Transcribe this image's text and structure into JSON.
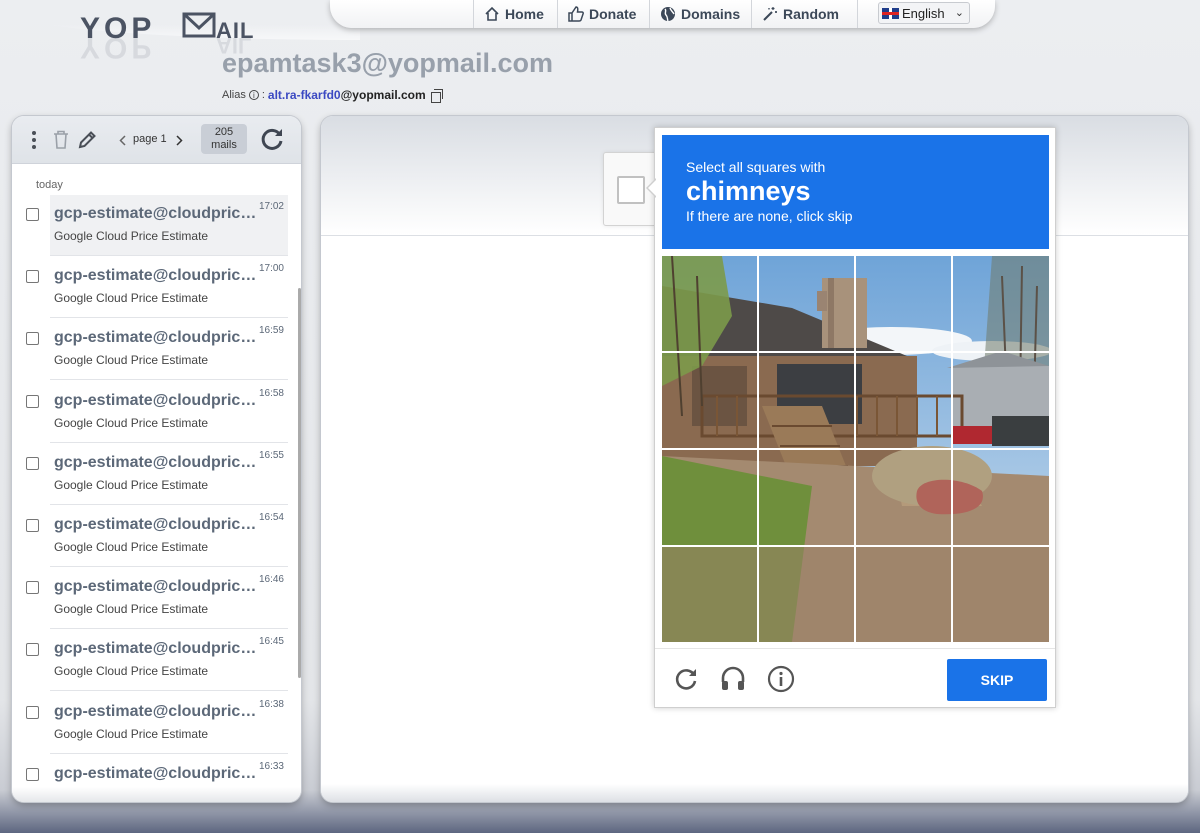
{
  "logo": {
    "text": "YOPMAIL"
  },
  "nav": {
    "items": [
      {
        "label": "Home",
        "icon": "home-icon"
      },
      {
        "label": "Donate",
        "icon": "thumbs-up-icon"
      },
      {
        "label": "Domains",
        "icon": "globe-icon"
      },
      {
        "label": "Random",
        "icon": "magic-wand-icon"
      }
    ],
    "language": "English"
  },
  "mailbox": {
    "address": "epamtask3@yopmail.com",
    "alias_label": "Alias",
    "alias_sep": ":",
    "alias_name": "alt.ra-fkarfd0",
    "alias_domain": "@yopmail.com"
  },
  "inbox_toolbar": {
    "page_label": "page 1",
    "mail_count": "205",
    "mail_count_unit": "mails"
  },
  "inbox": {
    "day_label": "today",
    "mails": [
      {
        "from": "gcp-estimate@cloudpricingcalculator.appspotmail.com",
        "subject": "Google Cloud Price Estimate",
        "time": "17:02"
      },
      {
        "from": "gcp-estimate@cloudpricingcalculator.appspotmail.com",
        "subject": "Google Cloud Price Estimate",
        "time": "17:00"
      },
      {
        "from": "gcp-estimate@cloudpricingcalculator.appspotmail.com",
        "subject": "Google Cloud Price Estimate",
        "time": "16:59"
      },
      {
        "from": "gcp-estimate@cloudpricingcalculator.appspotmail.com",
        "subject": "Google Cloud Price Estimate",
        "time": "16:58"
      },
      {
        "from": "gcp-estimate@cloudpricingcalculator.appspotmail.com",
        "subject": "Google Cloud Price Estimate",
        "time": "16:55"
      },
      {
        "from": "gcp-estimate@cloudpricingcalculator.appspotmail.com",
        "subject": "Google Cloud Price Estimate",
        "time": "16:54"
      },
      {
        "from": "gcp-estimate@cloudpricingcalculator.appspotmail.com",
        "subject": "Google Cloud Price Estimate",
        "time": "16:46"
      },
      {
        "from": "gcp-estimate@cloudpricingcalculator.appspotmail.com",
        "subject": "Google Cloud Price Estimate",
        "time": "16:45"
      },
      {
        "from": "gcp-estimate@cloudpricingcalculator.appspotmail.com",
        "subject": "Google Cloud Price Estimate",
        "time": "16:38"
      },
      {
        "from": "gcp-estimate@cloudpricingcalculator.appspotmail.com",
        "subject": "",
        "time": "16:33"
      }
    ]
  },
  "captcha": {
    "line1": "Select all squares with",
    "target": "chimneys",
    "line3": "If there are none, click skip",
    "skip_label": "SKIP",
    "accent_color": "#1a73e8"
  }
}
